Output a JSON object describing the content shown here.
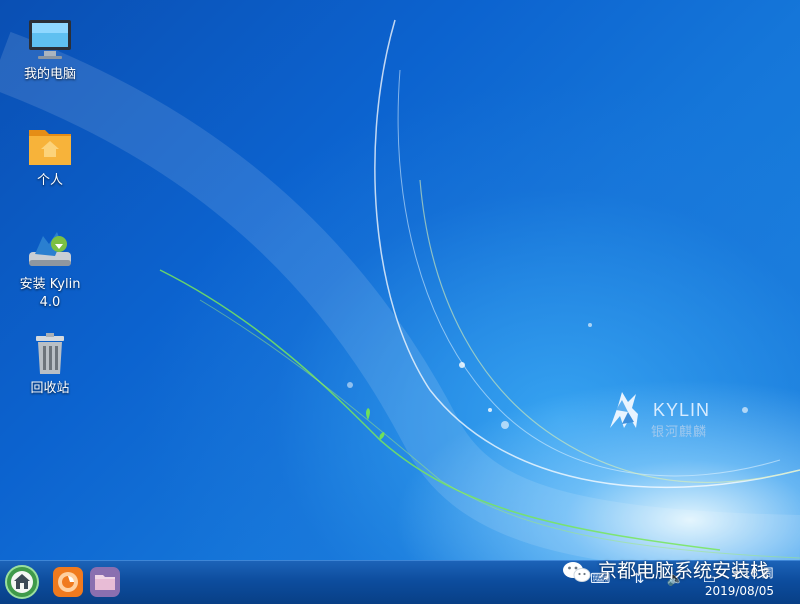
{
  "desktop": {
    "icons": [
      {
        "label": "我的电脑",
        "icon": "computer-icon"
      },
      {
        "label": "个人",
        "icon": "home-folder-icon"
      },
      {
        "label": "安装 Kylin 4.0",
        "icon": "installer-icon"
      },
      {
        "label": "回收站",
        "icon": "trash-icon"
      }
    ],
    "brand": {
      "name": "KYLIN",
      "cn_name": "银河麒麟"
    }
  },
  "taskbar": {
    "start_icon": "home-start-icon",
    "launchers": [
      {
        "name": "firefox-icon"
      },
      {
        "name": "file-manager-icon"
      }
    ],
    "clock_time": "9:18 周",
    "clock_date": "2019/08/05",
    "tray_icons": [
      "keyboard-icon",
      "network-icon",
      "volume-icon",
      "display-icon"
    ]
  },
  "watermark": {
    "text": "京都电脑系统安装栈"
  },
  "colors": {
    "desktop_blue": "#0c63cf",
    "taskbar_blue": "#0d4d9e",
    "folder_orange": "#f4a52a"
  }
}
